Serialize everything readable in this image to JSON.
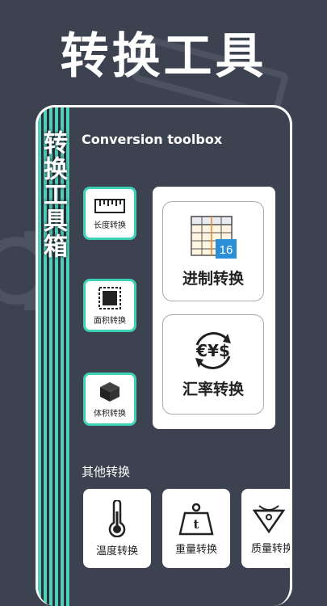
{
  "headline": "转换工具",
  "side_title": "转换工具箱",
  "subtitle": "Conversion toolbox",
  "small_tools": [
    {
      "label": "长度转换",
      "icon": "ruler-icon"
    },
    {
      "label": "面积转换",
      "icon": "area-square-icon"
    },
    {
      "label": "体积转换",
      "icon": "cube-icon"
    }
  ],
  "big_tools": [
    {
      "label": "进制转换",
      "icon": "base-table-icon",
      "badge": "16"
    },
    {
      "label": "汇率转换",
      "icon": "currency-exchange-icon"
    }
  ],
  "other_section": {
    "label": "其他转换",
    "items": [
      {
        "label": "温度转换",
        "icon": "thermometer-icon"
      },
      {
        "label": "重量转换",
        "icon": "weight-icon",
        "glyph": "t"
      },
      {
        "label": "质量转换",
        "icon": "mass-icon"
      }
    ]
  },
  "colors": {
    "background": "#3d4250",
    "accent": "#3ed0b4",
    "card": "#ffffff",
    "badge": "#2a8fd6"
  }
}
